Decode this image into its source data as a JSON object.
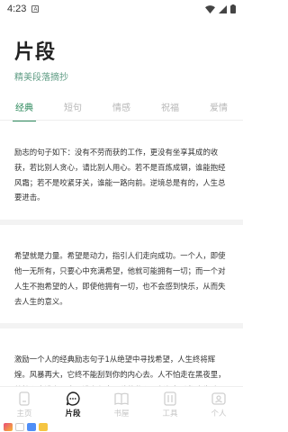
{
  "status": {
    "time": "4:23"
  },
  "header": {
    "title": "片段",
    "subtitle": "精美段落摘抄"
  },
  "tabs": [
    {
      "label": "经典",
      "active": true
    },
    {
      "label": "短句",
      "active": false
    },
    {
      "label": "情感",
      "active": false
    },
    {
      "label": "祝福",
      "active": false
    },
    {
      "label": "爱情",
      "active": false
    }
  ],
  "cards": [
    {
      "text": "励志的句子如下：没有不劳而获的工作，更没有坐享其成的收获，若比别人贪心，请比别人用心。若不是百炼成钢，谁能抱经风霜；若不是咬紧牙关，谁能一路向前。逆境总是有的，人生总要进击。"
    },
    {
      "text": "希望就是力量。希望是动力，指引人们走向成功。一个人，即使他一无所有，只要心中充满希望，他就可能拥有一切；而一个对人生不抱希望的人，即使他拥有一切，也不会感到快乐，从而失去人生的意义。"
    },
    {
      "text": "激励一个人的经典励志句子1从绝望中寻找希望，人生终将辉煌。风暴再大，它终不能刮到你的内心去。人不怕走在黑夜里，就怕心中没有阳光。没有坚定不移的信心，任何行动都会失败。"
    }
  ],
  "nav": [
    {
      "label": "主页",
      "icon": "home-icon",
      "active": false
    },
    {
      "label": "片段",
      "icon": "chat-icon",
      "active": true
    },
    {
      "label": "书屋",
      "icon": "book-icon",
      "active": false
    },
    {
      "label": "工具",
      "icon": "tools-icon",
      "active": false
    },
    {
      "label": "个人",
      "icon": "person-icon",
      "active": false
    }
  ],
  "colors": {
    "accent": "#2f8b5e",
    "subtitle": "#5f9c84"
  }
}
